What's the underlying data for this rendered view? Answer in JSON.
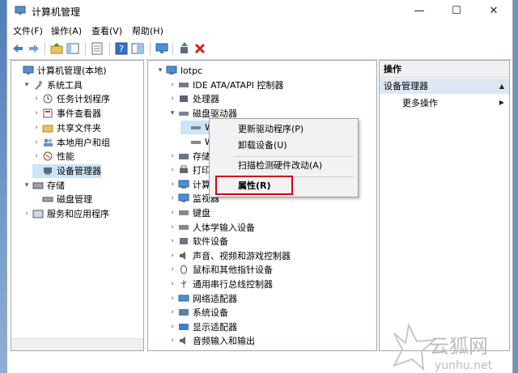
{
  "window": {
    "title": "计算机管理",
    "controls": [
      "—",
      "☐",
      "✕"
    ]
  },
  "menubar": [
    "文件(F)",
    "操作(A)",
    "查看(V)",
    "帮助(H)"
  ],
  "left_tree": [
    {
      "label": "计算机管理(本地)",
      "level": 0,
      "expander": "",
      "icon": "computer-management-icon"
    },
    {
      "label": "系统工具",
      "level": 1,
      "expander": "▾",
      "icon": "tools-icon"
    },
    {
      "label": "任务计划程序",
      "level": 2,
      "expander": "›",
      "icon": "task-scheduler-icon"
    },
    {
      "label": "事件查看器",
      "level": 2,
      "expander": "›",
      "icon": "event-viewer-icon"
    },
    {
      "label": "共享文件夹",
      "level": 2,
      "expander": "›",
      "icon": "shared-folders-icon"
    },
    {
      "label": "本地用户和组",
      "level": 2,
      "expander": "›",
      "icon": "users-icon"
    },
    {
      "label": "性能",
      "level": 2,
      "expander": "›",
      "icon": "performance-icon"
    },
    {
      "label": "设备管理器",
      "level": 2,
      "expander": "",
      "icon": "device-manager-icon",
      "selected": true
    },
    {
      "label": "存储",
      "level": 1,
      "expander": "▾",
      "icon": "storage-icon"
    },
    {
      "label": "磁盘管理",
      "level": 2,
      "expander": "",
      "icon": "disk-management-icon"
    },
    {
      "label": "服务和应用程序",
      "level": 1,
      "expander": "›",
      "icon": "services-icon"
    }
  ],
  "device_tree": [
    {
      "label": "lotpc",
      "level": 0,
      "expander": "▾",
      "icon": "computer-icon"
    },
    {
      "label": "IDE ATA/ATAPI 控制器",
      "level": 1,
      "expander": "›",
      "icon": "ide-controller-icon"
    },
    {
      "label": "处理器",
      "level": 1,
      "expander": "›",
      "icon": "processor-icon"
    },
    {
      "label": "磁盘驱动器",
      "level": 1,
      "expander": "▾",
      "icon": "disk-drive-icon"
    },
    {
      "label": "W",
      "level": 2,
      "expander": "",
      "icon": "disk-icon",
      "selected": true
    },
    {
      "label": "W",
      "level": 2,
      "expander": "",
      "icon": "disk-icon"
    },
    {
      "label": "存储",
      "level": 1,
      "expander": "›",
      "icon": "storage-controller-icon"
    },
    {
      "label": "打印",
      "level": 1,
      "expander": "›",
      "icon": "print-queue-icon"
    },
    {
      "label": "计算",
      "level": 1,
      "expander": "›",
      "icon": "computer-icon"
    },
    {
      "label": "监视器",
      "level": 1,
      "expander": "›",
      "icon": "monitor-icon"
    },
    {
      "label": "键盘",
      "level": 1,
      "expander": "›",
      "icon": "keyboard-icon"
    },
    {
      "label": "人体学输入设备",
      "level": 1,
      "expander": "›",
      "icon": "hid-icon"
    },
    {
      "label": "软件设备",
      "level": 1,
      "expander": "›",
      "icon": "software-device-icon"
    },
    {
      "label": "声音、视频和游戏控制器",
      "level": 1,
      "expander": "›",
      "icon": "sound-icon"
    },
    {
      "label": "鼠标和其他指针设备",
      "level": 1,
      "expander": "›",
      "icon": "mouse-icon"
    },
    {
      "label": "通用串行总线控制器",
      "level": 1,
      "expander": "›",
      "icon": "usb-icon"
    },
    {
      "label": "网络适配器",
      "level": 1,
      "expander": "›",
      "icon": "network-icon"
    },
    {
      "label": "系统设备",
      "level": 1,
      "expander": "›",
      "icon": "system-device-icon"
    },
    {
      "label": "显示适配器",
      "level": 1,
      "expander": "›",
      "icon": "display-adapter-icon"
    },
    {
      "label": "音频输入和输出",
      "level": 1,
      "expander": "›",
      "icon": "audio-icon"
    }
  ],
  "context_menu": {
    "update_driver": "更新驱动程序(P)",
    "uninstall": "卸载设备(U)",
    "scan": "扫描检测硬件改动(A)",
    "properties": "属性(R)"
  },
  "actions": {
    "header": "操作",
    "section": "设备管理器",
    "more": "更多操作"
  },
  "watermark": {
    "brand": "云狐网",
    "url": "yunhu.net"
  },
  "colors": {
    "highlight_border": "#d0021b",
    "selection": "#cce4f7",
    "action_section": "#dde7f3"
  }
}
